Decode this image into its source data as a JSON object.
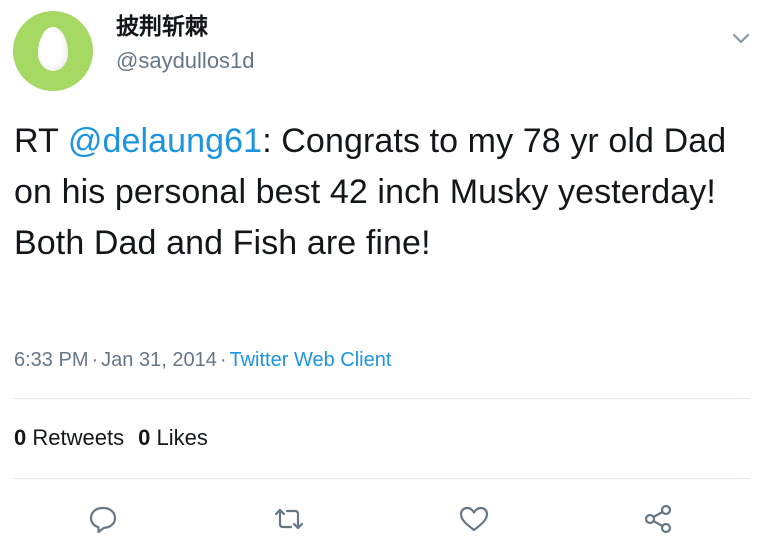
{
  "user": {
    "display_name": "披荆斩棘",
    "handle": "@saydullos1d",
    "avatar_icon": "egg-avatar-icon"
  },
  "tweet": {
    "prefix": "RT ",
    "mention": "@delaung61",
    "body": ": Congrats to my 78 yr old Dad on his personal best 42 inch Musky yesterday! Both Dad and Fish are fine!"
  },
  "meta": {
    "time": "6:33 PM",
    "separator": "·",
    "date": "Jan 31, 2014",
    "client": "Twitter Web Client"
  },
  "stats": {
    "retweets_count": "0",
    "retweets_label": "Retweets",
    "likes_count": "0",
    "likes_label": "Likes"
  },
  "actions": [
    "reply-icon",
    "retweet-icon",
    "like-icon",
    "share-icon"
  ],
  "colors": {
    "text": "#14171a",
    "secondary": "#657786",
    "link": "#1b95e0",
    "divider": "#e1e8ed",
    "avatar_bg": "#a6d864"
  }
}
